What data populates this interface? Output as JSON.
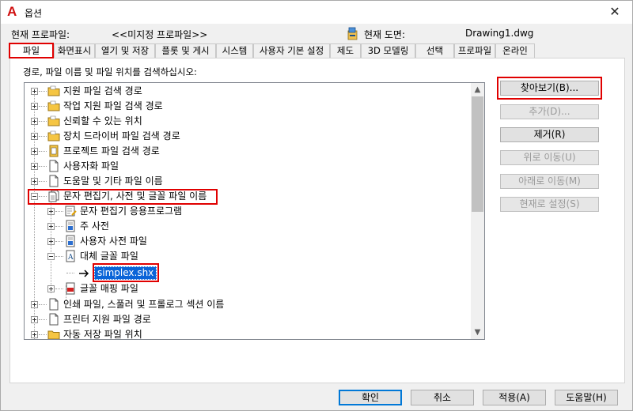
{
  "window": {
    "title": "옵션",
    "app_icon": "A",
    "close_glyph": "✕"
  },
  "profile": {
    "current_profile_label": "현재 프로파일:",
    "current_profile_value": "<<미지정 프로파일>>",
    "current_drawing_label": "현재 도면:",
    "current_drawing_value": "Drawing1.dwg"
  },
  "tabs": [
    {
      "label": "파일",
      "active": true
    },
    {
      "label": "화면표시"
    },
    {
      "label": "열기 및 저장"
    },
    {
      "label": "플롯 및 게시"
    },
    {
      "label": "시스템"
    },
    {
      "label": "사용자 기본 설정"
    },
    {
      "label": "제도"
    },
    {
      "label": "3D 모델링"
    },
    {
      "label": "선택"
    },
    {
      "label": "프로파일"
    },
    {
      "label": "온라인"
    }
  ],
  "panel": {
    "instruction": "경로, 파일 이름 및 파일 위치를 검색하십시오:"
  },
  "tree": {
    "nodes": [
      {
        "label": "지원 파일 검색 경로",
        "icon": "folder-icon"
      },
      {
        "label": "작업 지원 파일 검색 경로",
        "icon": "folder-icon"
      },
      {
        "label": "신뢰할 수 있는 위치",
        "icon": "folder-icon"
      },
      {
        "label": "장치 드라이버 파일 검색 경로",
        "icon": "folder-icon"
      },
      {
        "label": "프로젝트 파일 검색 경로",
        "icon": "project-icon"
      },
      {
        "label": "사용자화 파일",
        "icon": "file-icon"
      },
      {
        "label": "도움말 및 기타 파일 이름",
        "icon": "file-icon"
      },
      {
        "label": "문자 편집기, 사전 및 글꼴 파일 이름",
        "icon": "text-files-icon"
      },
      {
        "label": "문자 편집기 응용프로그램",
        "icon": "editor-app-icon"
      },
      {
        "label": "주 사전",
        "icon": "dictionary-icon"
      },
      {
        "label": "사용자 사전 파일",
        "icon": "dictionary-icon"
      },
      {
        "label": "대체 글꼴 파일",
        "icon": "font-file-icon"
      },
      {
        "label": "simplex.shx",
        "icon": "arrow-icon"
      },
      {
        "label": "글꼴 매핑 파일",
        "icon": "pdf-file-icon"
      },
      {
        "label": "인쇄 파일, 스풀러 및 프롤로그 섹션 이름",
        "icon": "file-icon"
      },
      {
        "label": "프린터 지원 파일 경로",
        "icon": "file-icon"
      },
      {
        "label": "자동 저장 파일 위치",
        "icon": "folder-icon"
      }
    ]
  },
  "side_buttons": {
    "browse": "찾아보기(B)...",
    "add": "추가(D)...",
    "remove": "제거(R)",
    "move_up": "위로 이동(U)",
    "move_down": "아래로 이동(M)",
    "set_current": "현재로 설정(S)"
  },
  "bottom_buttons": {
    "ok": "확인",
    "cancel": "취소",
    "apply": "적용(A)",
    "help": "도움말(H)"
  },
  "colors": {
    "highlight": "#e00000",
    "selection": "#0a64d8",
    "app_icon": "#d01010"
  }
}
